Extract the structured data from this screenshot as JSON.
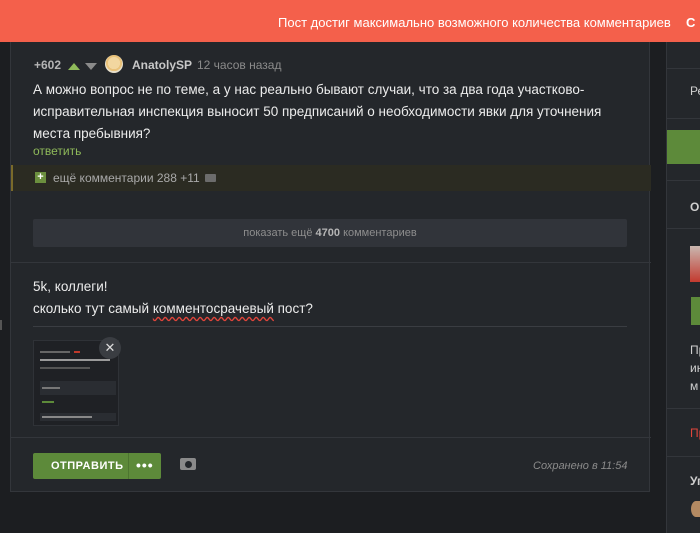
{
  "banner": {
    "message": "Пост достиг максимально возможного количества комментариев",
    "close": "С"
  },
  "comment": {
    "rating": "+602",
    "author": "AnatolySP",
    "time": "12 часов назад",
    "text": "А можно вопрос не по теме, а у нас реально бывают случаи, что за два года участково-исправительная инспекция выносит 50 предписаний о необходимости явки для уточнения места пребывния?",
    "reply": "ответить"
  },
  "more_comments": {
    "plus": "+",
    "label": "ещё комментарии 288 +11"
  },
  "show_more": {
    "prefix": "показать ещё",
    "count": "4700",
    "suffix": "комментариев"
  },
  "draft": {
    "line1": "5k, коллеги!",
    "line2_prefix": "сколько тут самый ",
    "line2_misspelled": "комментосрачевый",
    "line2_suffix": " пост?"
  },
  "attachment": {
    "close": "✕"
  },
  "editor": {
    "submit_label": "ОТПРАВИТЬ",
    "more_dots": "•••",
    "saved": "Сохранено в 11:54"
  },
  "sidebar": {
    "t1": "Ре",
    "t2": "О",
    "t3": "Пр",
    "t4": "ин",
    "t5": "м",
    "t6": "Пр",
    "t7": "Уг"
  },
  "colors": {
    "accent_green": "#5d8a3a",
    "banner_red": "#f4604b",
    "link_green": "#8fba5a"
  }
}
